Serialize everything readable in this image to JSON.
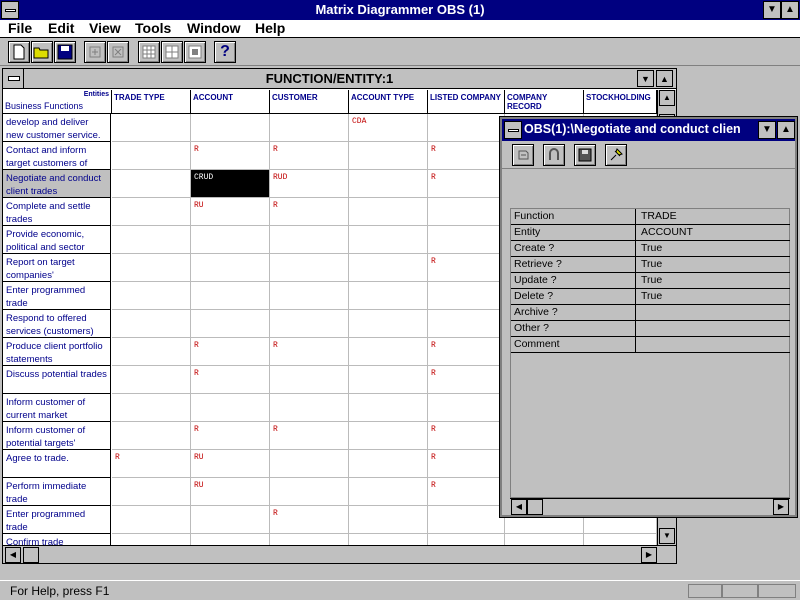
{
  "app": {
    "title": "Matrix Diagrammer OBS (1)"
  },
  "menu": [
    "File",
    "Edit",
    "View",
    "Tools",
    "Window",
    "Help"
  ],
  "toolbar": {
    "icons": [
      "new-file-icon",
      "open-folder-icon",
      "save-disk-icon",
      "add-row-icon",
      "delete-row-icon",
      "grid-view-icon",
      "grid-expand-icon",
      "grid-collapse-icon",
      "help-icon"
    ],
    "help_label": "?"
  },
  "matrix": {
    "title": "FUNCTION/ENTITY:1",
    "corner_top": "Entities",
    "corner_bottom": "Business Functions",
    "columns": [
      "TRADE TYPE",
      "ACCOUNT",
      "CUSTOMER",
      "ACCOUNT TYPE",
      "LISTED COMPANY",
      "COMPANY RECORD",
      "STOCKHOLDING"
    ],
    "rows": [
      {
        "label": "develop and deliver new customer service.",
        "cells": [
          "",
          "",
          "",
          "CDA",
          "",
          "",
          ""
        ]
      },
      {
        "label": "Contact and inform target customers of",
        "cells": [
          "",
          "R",
          "R",
          "",
          "R",
          "",
          ""
        ]
      },
      {
        "label": "Negotiate and conduct client trades",
        "cells": [
          "",
          "CRUD",
          "RUD",
          "",
          "R",
          "",
          ""
        ]
      },
      {
        "label": "Complete and settle trades",
        "cells": [
          "",
          "RU",
          "R",
          "",
          "",
          "",
          ""
        ]
      },
      {
        "label": "Provide economic, political and sector",
        "cells": [
          "",
          "",
          "",
          "",
          "",
          "",
          ""
        ]
      },
      {
        "label": "Report on target companies'",
        "cells": [
          "",
          "",
          "",
          "",
          "R",
          "",
          ""
        ]
      },
      {
        "label": "Enter programmed trade",
        "cells": [
          "",
          "",
          "",
          "",
          "",
          "",
          ""
        ]
      },
      {
        "label": "Respond to offered services (customers)",
        "cells": [
          "",
          "",
          "",
          "",
          "",
          "",
          ""
        ]
      },
      {
        "label": "Produce client portfolio statements",
        "cells": [
          "",
          "R",
          "R",
          "",
          "R",
          "",
          ""
        ]
      },
      {
        "label": "Discuss potential trades",
        "cells": [
          "",
          "R",
          "",
          "",
          "R",
          "",
          ""
        ]
      },
      {
        "label": "Inform customer of current market",
        "cells": [
          "",
          "",
          "",
          "",
          "",
          "",
          ""
        ]
      },
      {
        "label": "Inform customer of potential targets'",
        "cells": [
          "",
          "R",
          "R",
          "",
          "R",
          "",
          ""
        ]
      },
      {
        "label": "Agree to trade.",
        "cells": [
          "R",
          "RU",
          "",
          "",
          "R",
          "",
          ""
        ]
      },
      {
        "label": "Perform immediate trade",
        "cells": [
          "",
          "RU",
          "",
          "",
          "R",
          "",
          ""
        ]
      },
      {
        "label": "Enter programmed trade",
        "cells": [
          "",
          "",
          "R",
          "",
          "",
          "",
          ""
        ]
      },
      {
        "label": "Confirm trade",
        "cells": [
          "",
          "",
          "",
          "",
          "",
          "",
          ""
        ]
      }
    ]
  },
  "obs": {
    "title": "OBS(1):\\Negotiate and conduct clien",
    "properties": [
      {
        "key": "Function",
        "value": "TRADE"
      },
      {
        "key": "Entity",
        "value": "ACCOUNT"
      },
      {
        "key": "Create ?",
        "value": "True"
      },
      {
        "key": "Retrieve ?",
        "value": "True"
      },
      {
        "key": "Update ?",
        "value": "True"
      },
      {
        "key": "Delete ?",
        "value": "True"
      },
      {
        "key": "Archive ?",
        "value": ""
      },
      {
        "key": "Other ?",
        "value": ""
      },
      {
        "key": "Comment",
        "value": ""
      }
    ]
  },
  "status": {
    "text": "For Help, press F1"
  },
  "colors": {
    "title_active": "#000080",
    "cell_text": "#c00000",
    "label_text": "#00008b"
  }
}
